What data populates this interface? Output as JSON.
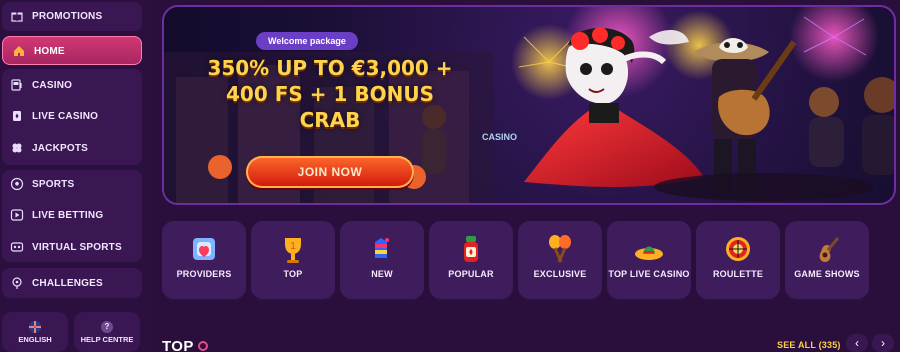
{
  "sidebar": {
    "items": [
      {
        "label": "PROMOTIONS",
        "icon": "gift-icon"
      },
      {
        "label": "HOME",
        "icon": "house-icon",
        "active": true
      },
      {
        "label": "CASINO",
        "icon": "slot-machine-icon"
      },
      {
        "label": "LIVE CASINO",
        "icon": "cards-icon"
      },
      {
        "label": "JACKPOTS",
        "icon": "clover-icon"
      },
      {
        "label": "SPORTS",
        "icon": "soccer-ball-icon"
      },
      {
        "label": "LIVE BETTING",
        "icon": "play-icon"
      },
      {
        "label": "VIRTUAL SPORTS",
        "icon": "vr-icon"
      },
      {
        "label": "CHALLENGES",
        "icon": "target-icon"
      }
    ],
    "bottom": {
      "language": "ENGLISH",
      "help": "HELP CENTRE"
    }
  },
  "banner": {
    "pill": "Welcome package",
    "headline": "350% UP TO €3,000 +\n400 FS + 1 BONUS\nCRAB",
    "cta": "JOIN NOW",
    "sign": "CASINO"
  },
  "categories": [
    {
      "label": "PROVIDERS",
      "icon": "providers-icon"
    },
    {
      "label": "TOP",
      "icon": "trophy-icon"
    },
    {
      "label": "NEW",
      "icon": "pinata-icon"
    },
    {
      "label": "POPULAR",
      "icon": "tabasco-icon"
    },
    {
      "label": "EXCLUSIVE",
      "icon": "maracas-icon"
    },
    {
      "label": "TOP LIVE CASINO",
      "icon": "sombrero-icon"
    },
    {
      "label": "ROULETTE",
      "icon": "roulette-icon"
    },
    {
      "label": "GAME SHOWS",
      "icon": "guitar-icon"
    }
  ],
  "section": {
    "title": "TOP",
    "see_all": "SEE ALL (335)"
  },
  "colors": {
    "bg": "#2a0f3d",
    "sidebar_bg": "#3a1752",
    "active": "#d23a73",
    "gold": "#ffd44d"
  }
}
